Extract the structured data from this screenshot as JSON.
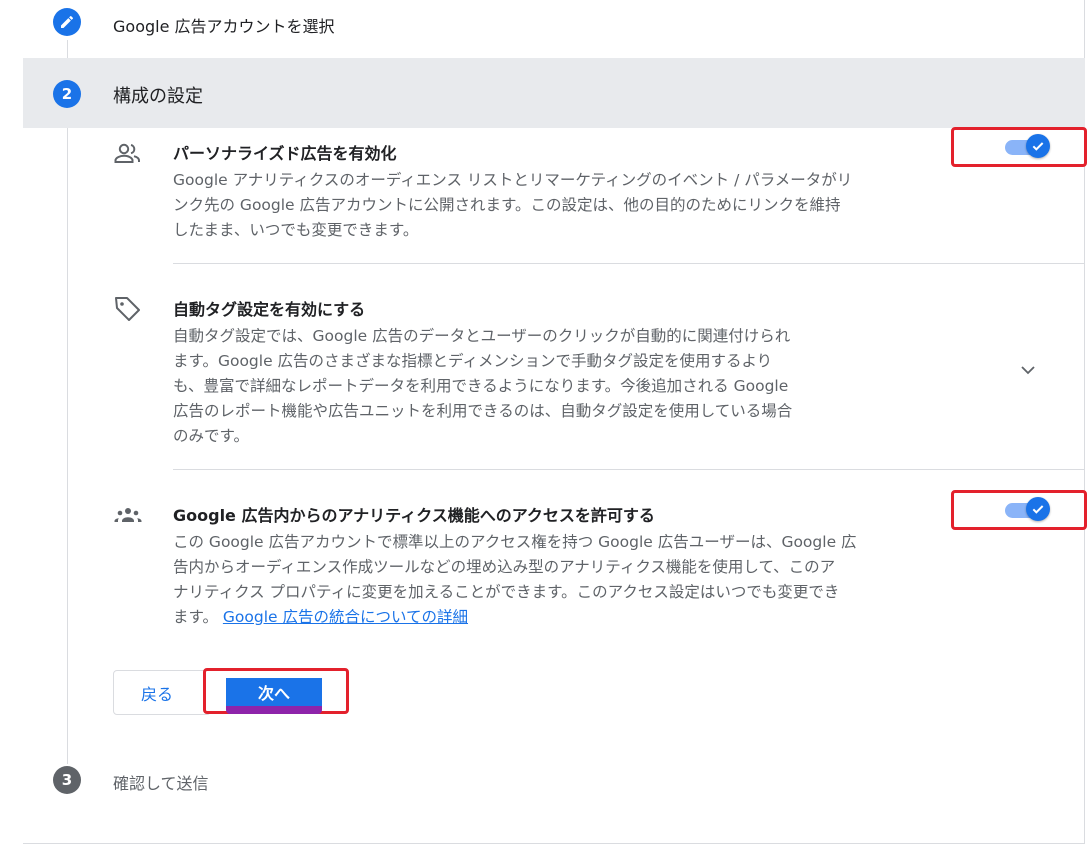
{
  "steps": [
    {
      "number": "",
      "label": "Google 広告アカウントを選択",
      "state": "completed",
      "icon": "pencil-icon"
    },
    {
      "number": "2",
      "label": "構成の設定",
      "state": "active"
    },
    {
      "number": "3",
      "label": "確認して送信",
      "state": "pending"
    }
  ],
  "settings": [
    {
      "icon": "people-icon",
      "title": "パーソナライズド広告を有効化",
      "description_lines": [
        "Google アナリティクスのオーディエンス リストとリマーケティングのイベント / パラメータがリ",
        "ンク先の Google 広告アカウントに公開されます。この設定は、他の目的のためにリンクを維持",
        "したまま、いつでも変更できます。"
      ],
      "toggle": "on"
    },
    {
      "icon": "tag-icon",
      "title": "自動タグ設定を有効にする",
      "description_lines": [
        "自動タグ設定では、Google 広告のデータとユーザーのクリックが自動的に関連付けられ",
        "ます。Google 広告のさまざまな指標とディメンションで手動タグ設定を使用するより",
        "も、豊富で詳細なレポートデータを利用できるようになります。今後追加される Google",
        "広告のレポート機能や広告ユニットを利用できるのは、自動タグ設定を使用している場合",
        "のみです。"
      ],
      "expand_icon": "chevron-down-icon"
    },
    {
      "icon": "groups-icon",
      "title": "Google 広告内からのアナリティクス機能へのアクセスを許可する",
      "description_lines": [
        "この Google 広告アカウントで標準以上のアクセス権を持つ Google 広告ユーザーは、Google 広",
        "告内からオーディエンス作成ツールなどの埋め込み型のアナリティクス機能を使用して、このア",
        "ナリティクス プロパティに変更を加えることができます。このアクセス設定はいつでも変更でき"
      ],
      "last_line_prefix": "ます。",
      "link_text": "Google 広告の統合についての詳細",
      "toggle": "on"
    }
  ],
  "buttons": {
    "back": "戻る",
    "next": "次へ"
  },
  "colors": {
    "accent": "#1a73e8",
    "highlight": "#e3212c",
    "active_band": "#e8eaed"
  }
}
